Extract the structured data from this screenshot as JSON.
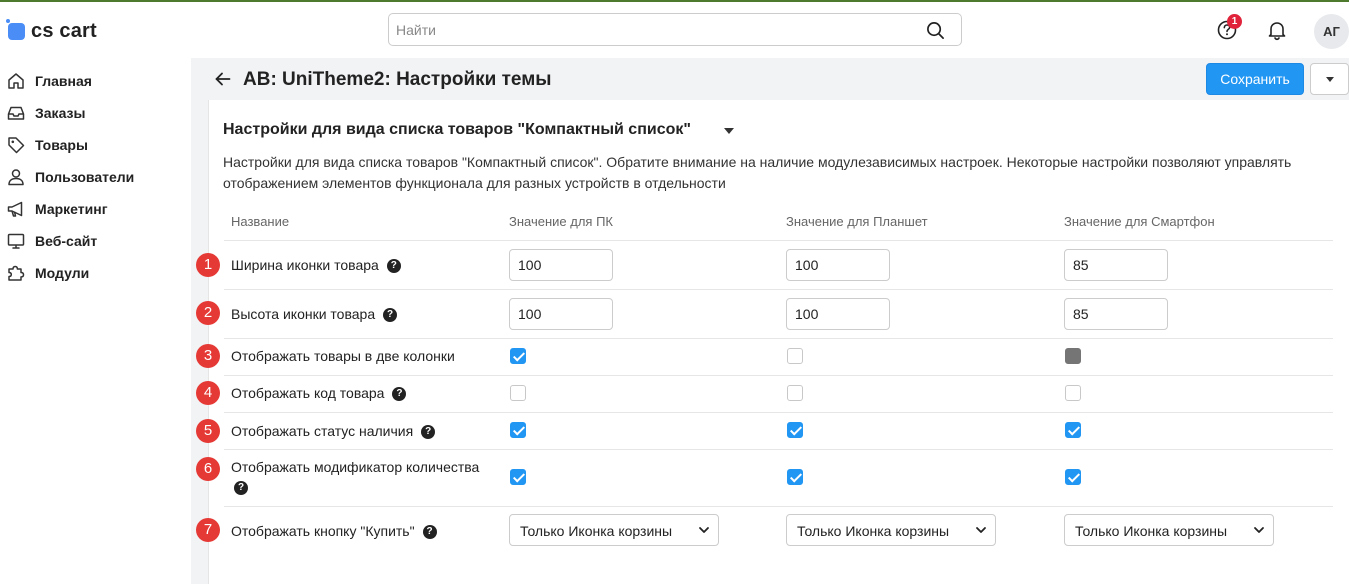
{
  "app": {
    "logo_text": "cs cart"
  },
  "search": {
    "placeholder": "Найти",
    "value": ""
  },
  "header": {
    "notification_count": "1",
    "avatar_initials": "АГ",
    "title": "AB: UniTheme2: Настройки темы",
    "save_label": "Сохранить"
  },
  "sidebar": {
    "items": [
      {
        "label": "Главная",
        "icon": "home-icon"
      },
      {
        "label": "Заказы",
        "icon": "inbox-icon"
      },
      {
        "label": "Товары",
        "icon": "tag-icon"
      },
      {
        "label": "Пользователи",
        "icon": "user-icon"
      },
      {
        "label": "Маркетинг",
        "icon": "megaphone-icon"
      },
      {
        "label": "Веб-сайт",
        "icon": "monitor-icon"
      },
      {
        "label": "Модули",
        "icon": "puzzle-icon"
      }
    ]
  },
  "section": {
    "title": "Настройки для вида списка товаров \"Компактный список\"",
    "description": "Настройки для вида списка товаров \"Компактный список\". Обратите внимание на наличие модулезависимых настроек. Некоторые настройки позволяют управлять отображением элементов функционала для разных устройств в отдельности"
  },
  "table": {
    "headers": [
      "Название",
      "Значение для ПК",
      "Значение для Планшет",
      "Значение для Смартфон"
    ],
    "rows": [
      {
        "num": "1",
        "label": "Ширина иконки товара",
        "help": true,
        "type": "text",
        "values": [
          "100",
          "100",
          "85"
        ]
      },
      {
        "num": "2",
        "label": "Высота иконки товара",
        "help": true,
        "type": "text",
        "values": [
          "100",
          "100",
          "85"
        ]
      },
      {
        "num": "3",
        "label": "Отображать товары в две колонки",
        "help": false,
        "type": "checkbox",
        "values": [
          "checked",
          "unchecked",
          "indeterminate-gray"
        ]
      },
      {
        "num": "4",
        "label": "Отображать код товара",
        "help": true,
        "type": "checkbox",
        "values": [
          "unchecked",
          "unchecked",
          "unchecked"
        ]
      },
      {
        "num": "5",
        "label": "Отображать статус наличия",
        "help": true,
        "type": "checkbox",
        "values": [
          "checked",
          "checked",
          "checked"
        ]
      },
      {
        "num": "6",
        "label": "Отображать модификатор количества",
        "help": true,
        "type": "checkbox",
        "values": [
          "checked",
          "checked",
          "checked"
        ]
      },
      {
        "num": "7",
        "label": "Отображать кнопку \"Купить\"",
        "help": true,
        "type": "select",
        "values": [
          "Только Иконка корзины",
          "Только Иконка корзины",
          "Только Иконка корзины"
        ]
      }
    ]
  },
  "colors": {
    "accent": "#2196f3",
    "badge": "#e0223a",
    "row_number": "#e53935",
    "checkbox_disabled": "#757575"
  }
}
